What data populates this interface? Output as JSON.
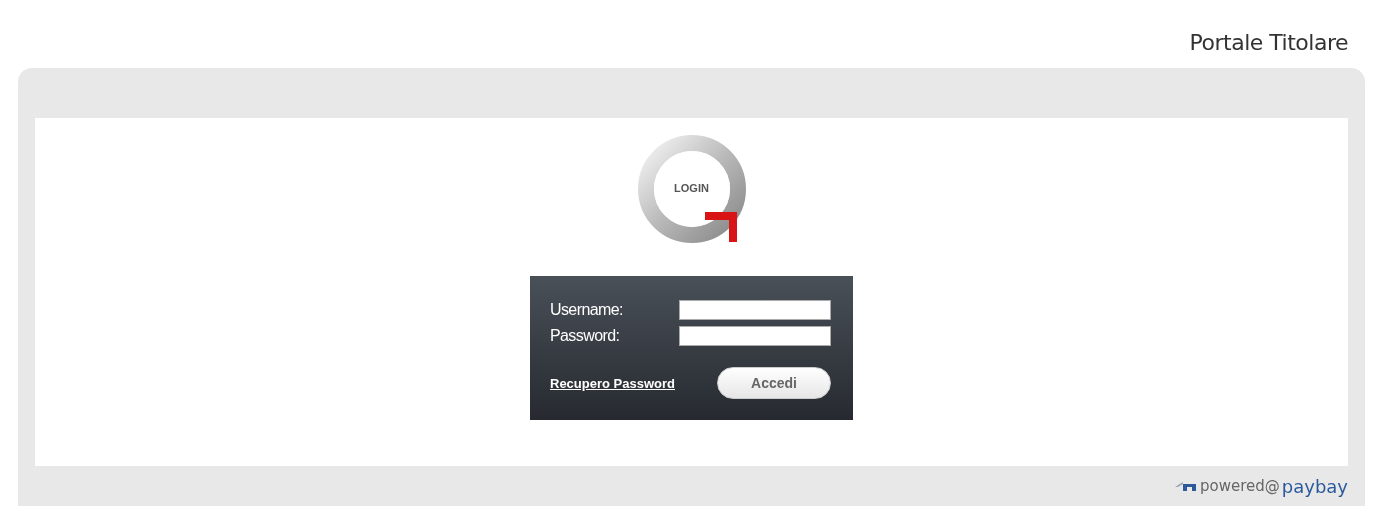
{
  "header": {
    "title": "Portale Titolare"
  },
  "logo": {
    "text": "LOGIN"
  },
  "login_form": {
    "fields": [
      {
        "label": "Username:"
      },
      {
        "label": "Password:"
      }
    ],
    "recover_link": "Recupero Password",
    "submit_button": "Accedi"
  },
  "footer": {
    "powered_text": "powered@",
    "brand": "paybay"
  }
}
